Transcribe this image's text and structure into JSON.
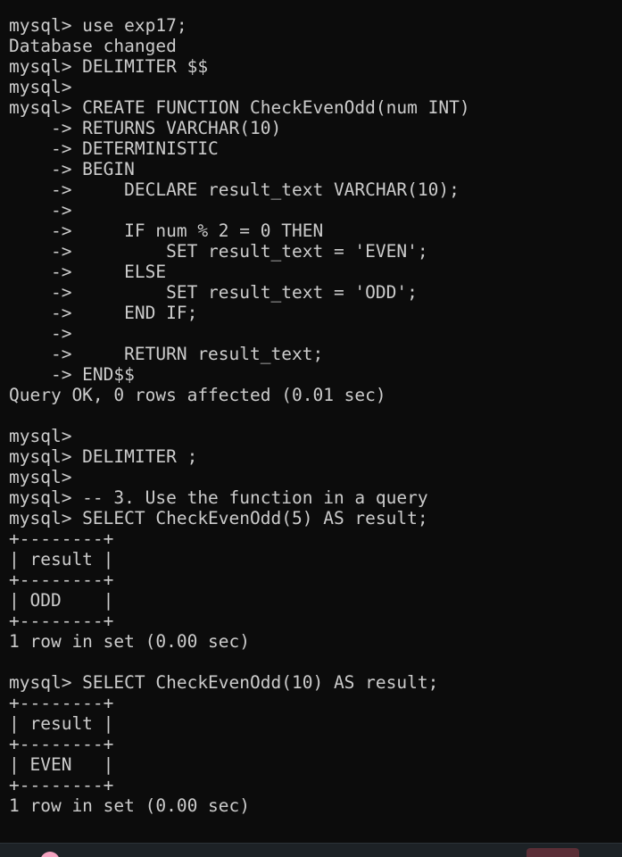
{
  "terminal": {
    "lines": [
      "mysql> use exp17;",
      "Database changed",
      "mysql> DELIMITER $$",
      "mysql>",
      "mysql> CREATE FUNCTION CheckEvenOdd(num INT)",
      "    -> RETURNS VARCHAR(10)",
      "    -> DETERMINISTIC",
      "    -> BEGIN",
      "    ->     DECLARE result_text VARCHAR(10);",
      "    ->",
      "    ->     IF num % 2 = 0 THEN",
      "    ->         SET result_text = 'EVEN';",
      "    ->     ELSE",
      "    ->         SET result_text = 'ODD';",
      "    ->     END IF;",
      "    ->",
      "    ->     RETURN result_text;",
      "    -> END$$",
      "Query OK, 0 rows affected (0.01 sec)",
      "",
      "mysql>",
      "mysql> DELIMITER ;",
      "mysql>",
      "mysql> -- 3. Use the function in a query",
      "mysql> SELECT CheckEvenOdd(5) AS result;",
      "+--------+",
      "| result |",
      "+--------+",
      "| ODD    |",
      "+--------+",
      "1 row in set (0.00 sec)",
      "",
      "mysql> SELECT CheckEvenOdd(10) AS result;",
      "+--------+",
      "| result |",
      "+--------+",
      "| EVEN   |",
      "+--------+",
      "1 row in set (0.00 sec)"
    ],
    "colors": {
      "background": "#0c0c0c",
      "foreground": "#cccccc"
    }
  },
  "taskbar": {
    "icons": [
      "app-icon",
      "active-window-item"
    ],
    "colors": {
      "background": "#1d2226",
      "app_icon": "#f4a3c0",
      "active_item": "#5a2e36"
    }
  }
}
